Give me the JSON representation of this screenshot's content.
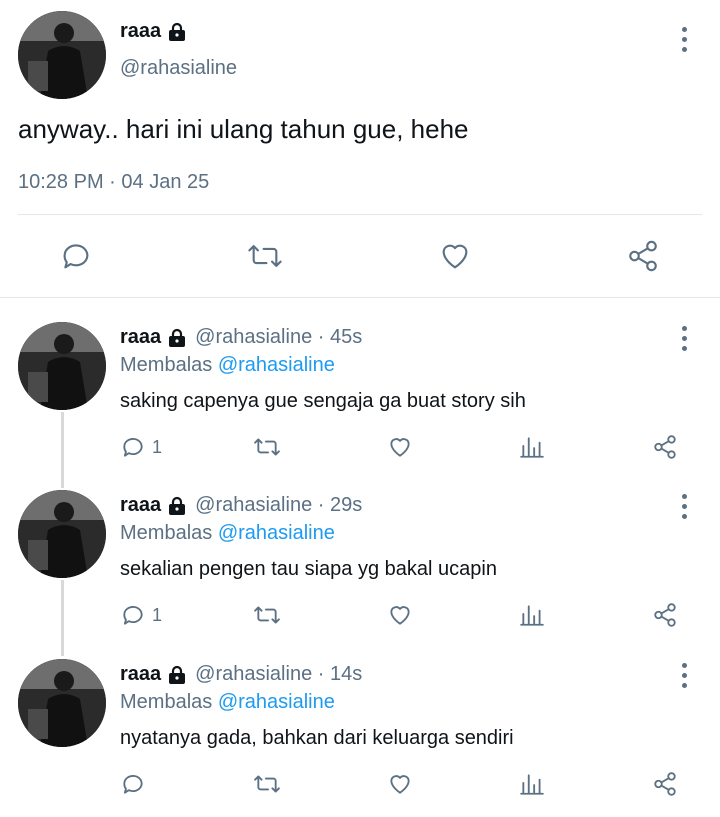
{
  "main_tweet": {
    "name": "raaa",
    "handle": "@rahasialine",
    "text": "anyway.. hari ini ulang tahun gue, hehe",
    "time": "10:28 PM",
    "separator": " · ",
    "date": "04 Jan 25"
  },
  "replies": [
    {
      "name": "raaa",
      "handle": "@rahasialine",
      "age": "45s",
      "replying_prefix": "Membalas ",
      "replying_to": "@rahasialine",
      "text": "saking capenya gue sengaja ga buat story sih",
      "reply_count": "1"
    },
    {
      "name": "raaa",
      "handle": "@rahasialine",
      "age": "29s",
      "replying_prefix": "Membalas ",
      "replying_to": "@rahasialine",
      "text": "sekalian pengen tau siapa yg bakal ucapin",
      "reply_count": "1"
    },
    {
      "name": "raaa",
      "handle": "@rahasialine",
      "age": "14s",
      "replying_prefix": "Membalas ",
      "replying_to": "@rahasialine",
      "text": "nyatanya gada, bahkan dari keluarga sendiri",
      "reply_count": ""
    }
  ],
  "icons": {
    "lock": "lock-icon",
    "more": "more-vertical-icon",
    "reply": "reply-icon",
    "retweet": "retweet-icon",
    "like": "heart-icon",
    "views": "analytics-icon",
    "share": "share-icon"
  },
  "colors": {
    "text": "#0f1419",
    "secondary": "#5b7083",
    "mention": "#1d9bf0",
    "divider": "#e1e8ed"
  }
}
